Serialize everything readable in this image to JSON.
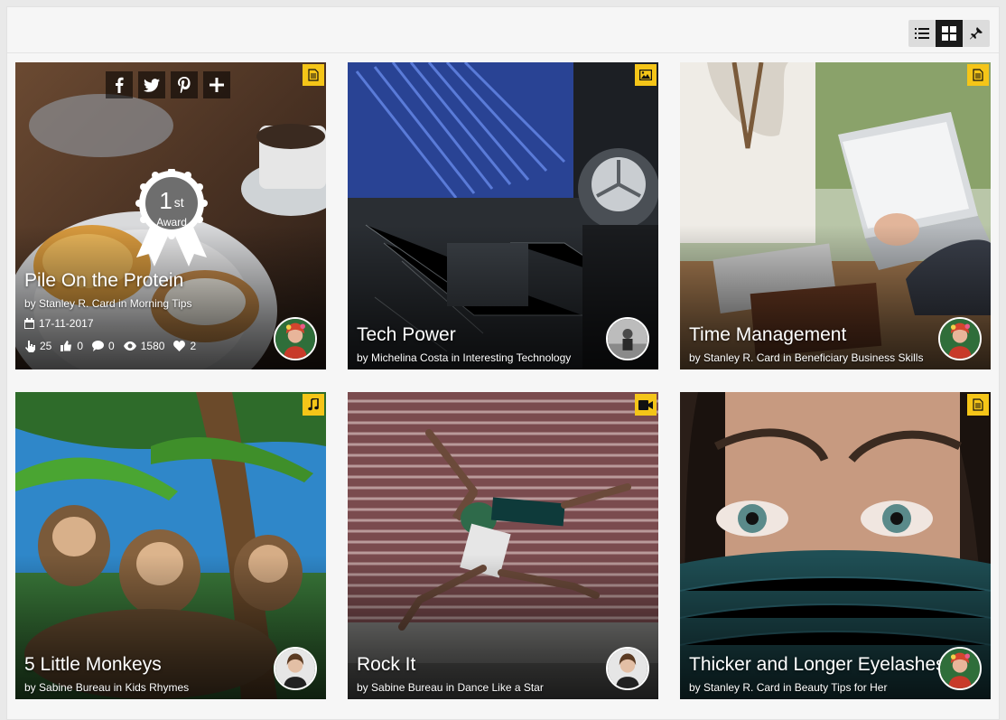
{
  "toolbar": {
    "views": [
      {
        "name": "list",
        "icon": "list-view-icon",
        "active": false
      },
      {
        "name": "grid",
        "icon": "grid-view-icon",
        "active": true
      },
      {
        "name": "pin",
        "icon": "pin-view-icon",
        "active": false
      }
    ]
  },
  "colors": {
    "badge": "#f5c518",
    "active_view": "#1a1a1a"
  },
  "cards": [
    {
      "title": "Pile On the Protein",
      "author": "Stanley R. Card",
      "in_word": "in",
      "category": "Morning Tips",
      "type_icon": "article-icon",
      "award": {
        "number": "1",
        "suffix": "st",
        "label": "Award"
      },
      "date": "17-11-2017",
      "stats": {
        "clicks": "25",
        "likes": "0",
        "comments": "0",
        "views": "1580",
        "loves": "2"
      },
      "share": [
        "facebook-icon",
        "twitter-icon",
        "pinterest-icon",
        "plus-icon"
      ]
    },
    {
      "title": "Tech Power",
      "author": "Michelina Costa",
      "in_word": "in",
      "category": "Interesting Technology",
      "type_icon": "image-icon"
    },
    {
      "title": "Time Management",
      "author": "Stanley R. Card",
      "in_word": "in",
      "category": "Beneficiary Business Skills",
      "type_icon": "article-icon"
    },
    {
      "title": "5 Little Monkeys",
      "author": "Sabine Bureau",
      "in_word": "in",
      "category": "Kids Rhymes",
      "type_icon": "music-icon"
    },
    {
      "title": "Rock It",
      "author": "Sabine Bureau",
      "in_word": "in",
      "category": "Dance Like a Star",
      "type_icon": "video-icon"
    },
    {
      "title": "Thicker and Longer Eyelashes",
      "author": "Stanley R. Card",
      "in_word": "in",
      "category": "Beauty Tips for Her",
      "type_icon": "article-icon"
    }
  ]
}
